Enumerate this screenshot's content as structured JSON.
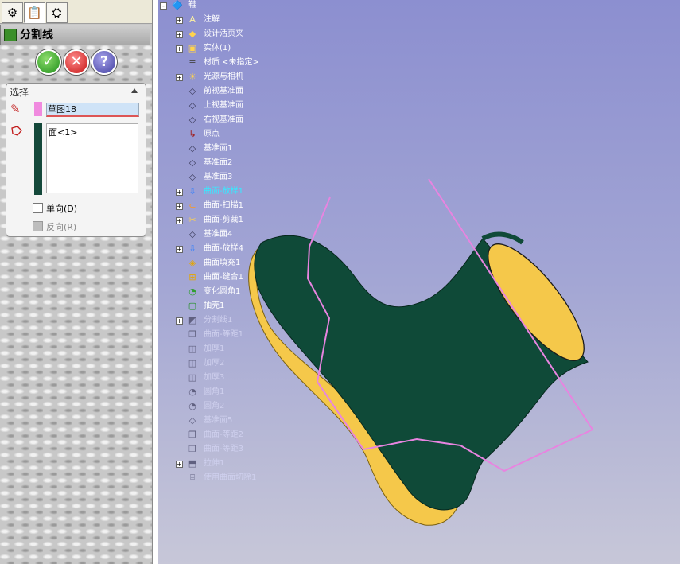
{
  "pm": {
    "tabs": [
      "feature-manager",
      "property-manager",
      "configuration-manager"
    ],
    "title": "分割线",
    "buttons": {
      "ok": "✓",
      "cancel": "✕",
      "help": "?"
    },
    "group": {
      "title": "选择",
      "sketch_value": "草图18",
      "face_value": "面<1>",
      "single_dir_label": "单向(D)",
      "reverse_label": "反向(R)"
    }
  },
  "tree": {
    "root": "鞋",
    "items": [
      {
        "label": "注解",
        "icon": "annotation-icon",
        "expand": true
      },
      {
        "label": "设计活页夹",
        "icon": "design-binder-icon",
        "expand": true
      },
      {
        "label": "实体(1)",
        "icon": "solid-body-icon",
        "expand": true
      },
      {
        "label": "材质 <未指定>",
        "icon": "material-icon",
        "expand": false
      },
      {
        "label": "光源与相机",
        "icon": "lights-icon",
        "expand": true
      },
      {
        "label": "前视基准面",
        "icon": "plane-icon",
        "expand": false
      },
      {
        "label": "上视基准面",
        "icon": "plane-icon",
        "expand": false
      },
      {
        "label": "右视基准面",
        "icon": "plane-icon",
        "expand": false
      },
      {
        "label": "原点",
        "icon": "origin-icon",
        "expand": false
      },
      {
        "label": "基准面1",
        "icon": "plane-icon",
        "expand": false
      },
      {
        "label": "基准面2",
        "icon": "plane-icon",
        "expand": false
      },
      {
        "label": "基准面3",
        "icon": "plane-icon",
        "expand": false
      },
      {
        "label": "曲面-放样1",
        "icon": "loft-icon",
        "expand": true,
        "highlight": true
      },
      {
        "label": "曲面-扫描1",
        "icon": "sweep-icon",
        "expand": true
      },
      {
        "label": "曲面-剪裁1",
        "icon": "trim-icon",
        "expand": true
      },
      {
        "label": "基准面4",
        "icon": "plane-icon",
        "expand": false
      },
      {
        "label": "曲面-放样4",
        "icon": "loft-icon",
        "expand": true
      },
      {
        "label": "曲面填充1",
        "icon": "fill-icon",
        "expand": false
      },
      {
        "label": "曲面-缝合1",
        "icon": "knit-icon",
        "expand": false
      },
      {
        "label": "变化圆角1",
        "icon": "fillet-icon",
        "expand": false
      },
      {
        "label": "抽壳1",
        "icon": "shell-icon",
        "expand": false
      },
      {
        "label": "分割线1",
        "icon": "split-icon",
        "expand": true,
        "gray": true
      },
      {
        "label": "曲面-等距1",
        "icon": "offset-icon",
        "expand": false,
        "gray": true
      },
      {
        "label": "加厚1",
        "icon": "thicken-icon",
        "expand": false,
        "gray": true
      },
      {
        "label": "加厚2",
        "icon": "thicken-icon",
        "expand": false,
        "gray": true
      },
      {
        "label": "加厚3",
        "icon": "thicken-icon",
        "expand": false,
        "gray": true
      },
      {
        "label": "圆角1",
        "icon": "fillet-icon",
        "expand": false,
        "gray": true
      },
      {
        "label": "圆角2",
        "icon": "fillet-icon",
        "expand": false,
        "gray": true
      },
      {
        "label": "基准面5",
        "icon": "plane-icon",
        "expand": false,
        "gray": true
      },
      {
        "label": "曲面-等距2",
        "icon": "offset-icon",
        "expand": false,
        "gray": true
      },
      {
        "label": "曲面-等距3",
        "icon": "offset-icon",
        "expand": false,
        "gray": true
      },
      {
        "label": "拉伸1",
        "icon": "extrude-icon",
        "expand": true,
        "gray": true
      },
      {
        "label": "使用曲面切除1",
        "icon": "surface-cut-icon",
        "expand": false,
        "gray": true
      }
    ]
  },
  "colors": {
    "boot": "#0f4a38",
    "sole": "#f5c84a",
    "sketch": "#e884e0",
    "highlight": "#37e9ff"
  }
}
